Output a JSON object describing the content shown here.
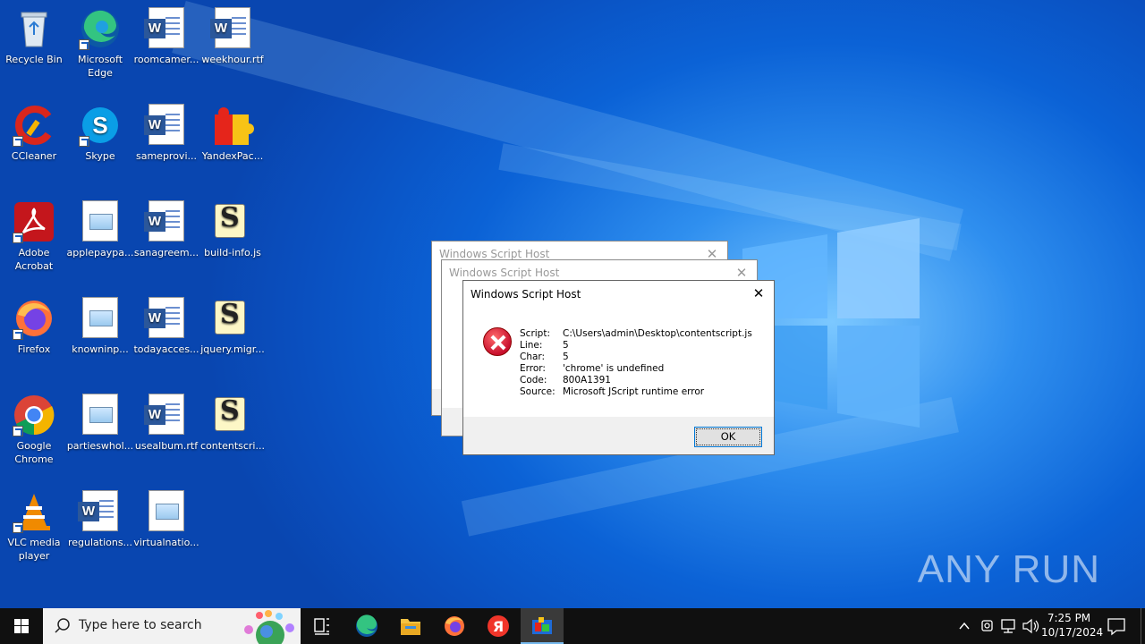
{
  "desktop": {
    "icons": [
      {
        "label": "Recycle Bin"
      },
      {
        "label": "Microsoft Edge"
      },
      {
        "label": "roomcamer..."
      },
      {
        "label": "weekhour.rtf"
      },
      {
        "label": "CCleaner"
      },
      {
        "label": "Skype"
      },
      {
        "label": "sameprovi..."
      },
      {
        "label": "YandexPac..."
      },
      {
        "label": "Adobe Acrobat"
      },
      {
        "label": "applepaypa..."
      },
      {
        "label": "sanagreem..."
      },
      {
        "label": "build-info.js"
      },
      {
        "label": "Firefox"
      },
      {
        "label": "knowninp..."
      },
      {
        "label": "todayacces..."
      },
      {
        "label": "jquery.migr..."
      },
      {
        "label": "Google Chrome"
      },
      {
        "label": "partieswhol..."
      },
      {
        "label": "usealbum.rtf"
      },
      {
        "label": "contentscri..."
      },
      {
        "label": "VLC media player"
      },
      {
        "label": "regulations..."
      },
      {
        "label": "virtualnatio..."
      }
    ]
  },
  "dialogs": {
    "back1_title": "Windows Script Host",
    "back2_title": "Windows Script Host",
    "main": {
      "title": "Windows Script Host",
      "close": "✕",
      "rows": [
        {
          "key": "Script:",
          "value": "C:\\Users\\admin\\Desktop\\contentscript.js"
        },
        {
          "key": "Line:",
          "value": "5"
        },
        {
          "key": "Char:",
          "value": "5"
        },
        {
          "key": "Error:",
          "value": "'chrome' is undefined"
        },
        {
          "key": "Code:",
          "value": "800A1391"
        },
        {
          "key": "Source:",
          "value": "Microsoft JScript runtime error"
        }
      ],
      "ok_label": "OK"
    }
  },
  "watermark": "ANY  RUN",
  "taskbar": {
    "search_placeholder": "Type here to search",
    "time": "7:25 PM",
    "date": "10/17/2024"
  },
  "colors": {
    "accent": "#0078d7",
    "taskbar": "#101010",
    "error_red": "#c8102e"
  }
}
